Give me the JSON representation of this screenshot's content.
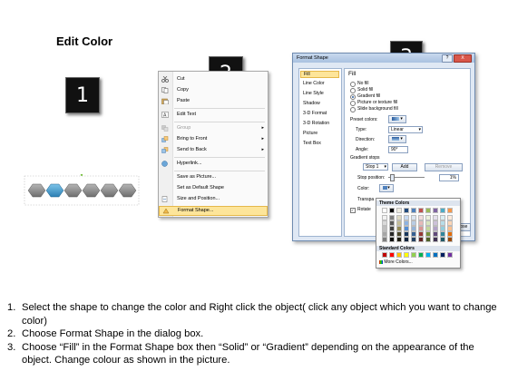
{
  "title": "Edit Color",
  "steps_labels": [
    "1",
    "2",
    "3"
  ],
  "context_menu": {
    "items": [
      {
        "label": "Cut",
        "icon": "scissors-icon",
        "disabled": false,
        "arrow": false
      },
      {
        "label": "Copy",
        "icon": "copy-icon",
        "disabled": false,
        "arrow": false
      },
      {
        "label": "Paste",
        "icon": "paste-icon",
        "disabled": false,
        "arrow": false
      },
      {
        "label": "Edit Text",
        "icon": "edit-text-icon",
        "disabled": false,
        "arrow": false
      },
      {
        "label": "Group",
        "icon": "group-icon",
        "disabled": true,
        "arrow": true
      },
      {
        "label": "Bring to Front",
        "icon": "bring-front-icon",
        "disabled": false,
        "arrow": true
      },
      {
        "label": "Send to Back",
        "icon": "send-back-icon",
        "disabled": false,
        "arrow": true
      },
      {
        "label": "Hyperlink...",
        "icon": "hyperlink-icon",
        "disabled": false,
        "arrow": false
      },
      {
        "label": "Save as Picture...",
        "icon": "",
        "disabled": false,
        "arrow": false
      },
      {
        "label": "Set as Default Shape",
        "icon": "",
        "disabled": false,
        "arrow": false
      },
      {
        "label": "Size and Position...",
        "icon": "size-icon",
        "disabled": false,
        "arrow": false
      },
      {
        "label": "Format Shape...",
        "icon": "format-shape-icon",
        "disabled": false,
        "arrow": false,
        "highlighted": true
      }
    ]
  },
  "dialog": {
    "title": "Format Shape",
    "window_buttons": [
      "?",
      "X"
    ],
    "categories": [
      "Fill",
      "Line Color",
      "Line Style",
      "Shadow",
      "3-D Format",
      "3-D Rotation",
      "Picture",
      "Text Box"
    ],
    "selected_category": "Fill",
    "section_title": "Fill",
    "fill_options": [
      {
        "label": "No fill",
        "selected": false
      },
      {
        "label": "Solid fill",
        "selected": false
      },
      {
        "label": "Gradient fill",
        "selected": true
      },
      {
        "label": "Picture or texture fill",
        "selected": false
      },
      {
        "label": "Slide background fill",
        "selected": false
      }
    ],
    "preset_colors_label": "Preset colors:",
    "type_label": "Type:",
    "type_value": "Linear",
    "direction_label": "Direction:",
    "angle_label": "Angle:",
    "angle_value": "90°",
    "gradient_stops_label": "Gradient stops",
    "stop_value": "Stop 1",
    "add_label": "Add",
    "remove_label": "Remove",
    "stop_position_label": "Stop position:",
    "stop_position_value": "1%",
    "color_label": "Color:",
    "transparency_label": "Transpa",
    "rotate_label": "Rotate",
    "close_label": "Close"
  },
  "color_popup": {
    "theme_label": "Theme Colors",
    "standard_label": "Standard Colors",
    "more_label": "More Colors...",
    "theme_top": [
      "#ffffff",
      "#000000",
      "#eeece1",
      "#1f497d",
      "#4f81bd",
      "#c0504d",
      "#9bbb59",
      "#8064a2",
      "#4bacc6",
      "#f79646"
    ],
    "theme_columns": [
      [
        "#f2f2f2",
        "#d9d9d9",
        "#bfbfbf",
        "#a6a6a6",
        "#808080"
      ],
      [
        "#7f7f7f",
        "#595959",
        "#404040",
        "#262626",
        "#0d0d0d"
      ],
      [
        "#ddd9c3",
        "#c4bd97",
        "#948a54",
        "#4a452a",
        "#1d1b10"
      ],
      [
        "#c6d9f1",
        "#8db3e2",
        "#548dd4",
        "#17365d",
        "#0f243e"
      ],
      [
        "#dbe5f1",
        "#b8cce4",
        "#95b3d7",
        "#366092",
        "#244061"
      ],
      [
        "#f2dcdb",
        "#e6b9b8",
        "#d99694",
        "#953734",
        "#632423"
      ],
      [
        "#ebf1dd",
        "#d7e4bc",
        "#c3d69b",
        "#76923c",
        "#4f6128"
      ],
      [
        "#e5e0ec",
        "#ccc1d9",
        "#b2a2c7",
        "#5f497a",
        "#3f3151"
      ],
      [
        "#dbeef3",
        "#b7dde8",
        "#92cddc",
        "#31859b",
        "#205867"
      ],
      [
        "#fdeada",
        "#fbd5b5",
        "#fac08f",
        "#e36c09",
        "#974806"
      ]
    ],
    "standard": [
      "#c00000",
      "#ff0000",
      "#ffc000",
      "#ffff00",
      "#92d050",
      "#00b050",
      "#00b0f0",
      "#0070c0",
      "#002060",
      "#7030a0"
    ]
  },
  "shapes": {
    "fill": "#8a8a8a",
    "selected_fill": "#4a9fd0"
  },
  "instructions": [
    {
      "num": "1.",
      "text": "Select the shape to change the color and Right click the object( click any object which you want to change color)"
    },
    {
      "num": "2.",
      "text": "Choose Format Shape in the dialog box."
    },
    {
      "num": "3.",
      "text": "Choose “Fill” in the Format Shape box then “Solid” or “Gradient” depending on the appearance of the object. Change colour as shown in the picture."
    }
  ]
}
